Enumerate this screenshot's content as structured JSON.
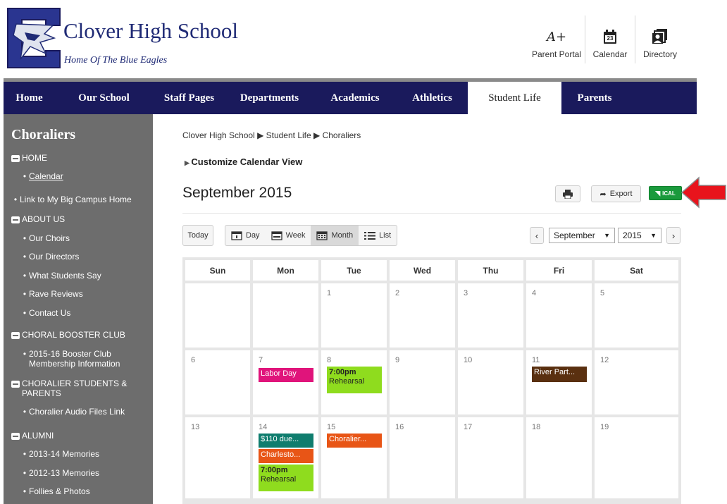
{
  "header": {
    "school_name": "Clover High School",
    "tagline": "Home Of The Blue Eagles",
    "quick_links": [
      {
        "label": "Parent Portal",
        "icon": "a-plus-icon",
        "glyph": "A+"
      },
      {
        "label": "Calendar",
        "icon": "calendar-icon",
        "glyph": "23"
      },
      {
        "label": "Directory",
        "icon": "directory-icon"
      }
    ]
  },
  "nav": {
    "items": [
      "Home",
      "Our School",
      "Staff Pages",
      "Departments",
      "Academics",
      "Athletics",
      "Student Life",
      "Parents"
    ],
    "active": "Student Life"
  },
  "sidebar": {
    "title": "Choraliers",
    "sections": [
      {
        "label": "HOME",
        "items": [
          "Calendar"
        ]
      },
      {
        "label": "Link to My Big Campus Home"
      },
      {
        "label": "ABOUT US",
        "items": [
          "Our Choirs",
          "Our Directors",
          "What Students Say",
          "Rave Reviews",
          "Contact Us"
        ]
      },
      {
        "label": "CHORAL BOOSTER CLUB",
        "items": [
          "2015-16 Booster Club Membership Information"
        ]
      },
      {
        "label": "CHORALIER STUDENTS & PARENTS",
        "items": [
          "Choralier Audio Files Link"
        ]
      },
      {
        "label": "ALUMNI",
        "items": [
          "2013-14 Memories",
          "2012-13 Memories",
          "Follies & Photos"
        ]
      }
    ]
  },
  "breadcrumb": [
    "Clover High School",
    "Student Life",
    "Choraliers"
  ],
  "customize_label": "Customize Calendar View",
  "calendar": {
    "title": "September 2015",
    "export_label": "Export",
    "ical_label": "ICAL",
    "today_label": "Today",
    "views": [
      "Day",
      "Week",
      "Month",
      "List"
    ],
    "active_view": "Month",
    "month_select": "September",
    "year_select": "2015",
    "weekdays": [
      "Sun",
      "Mon",
      "Tue",
      "Wed",
      "Thu",
      "Fri",
      "Sat"
    ],
    "weeks": [
      [
        "",
        "",
        "1",
        "2",
        "3",
        "4",
        "5"
      ],
      [
        "6",
        "7",
        "8",
        "9",
        "10",
        "11",
        "12"
      ],
      [
        "13",
        "14",
        "15",
        "16",
        "17",
        "18",
        "19"
      ]
    ],
    "events": {
      "labor_day": {
        "label": "Labor Day",
        "color": "#e0147b"
      },
      "rehearsal_8": {
        "time": "7:00pm",
        "label": "Rehearsal",
        "color": "#8fdc1e"
      },
      "river_party": {
        "label": "River Part...",
        "color": "#5a3010"
      },
      "due_14": {
        "label": "$110 due...",
        "color": "#0f7d6e"
      },
      "charleston_14": {
        "label": "Charlesto...",
        "color": "#e85516"
      },
      "rehearsal_14": {
        "time": "7:00pm",
        "label": "Rehearsal",
        "color": "#8fdc1e"
      },
      "choralier_15": {
        "label": "Choralier...",
        "color": "#e85516"
      }
    }
  },
  "colors": {
    "nav_bg": "#1a1a5c",
    "sidebar_bg": "#6d6d6d",
    "school_blue": "#1f2a75",
    "ical_green": "#1a9a3c",
    "arrow_red": "#e8141c"
  }
}
